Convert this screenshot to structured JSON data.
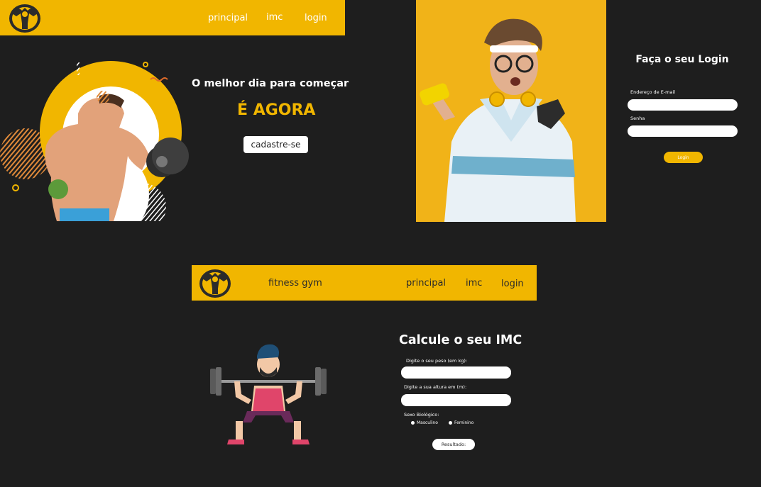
{
  "colors": {
    "accent": "#f1b600",
    "background": "#1e1e1e",
    "field": "#ffffff"
  },
  "home": {
    "nav": {
      "logo_icon": "gym-mascot-logo",
      "links": [
        "principal",
        "imc",
        "login"
      ]
    },
    "hero": {
      "tagline": "O melhor dia para começar",
      "highlight": "É AGORA",
      "signup_label": "cadastre-se"
    }
  },
  "login": {
    "title": "Faça o seu Login",
    "email_label": "Endereço de E-mail",
    "email_value": "",
    "password_label": "Senha",
    "password_value": "",
    "submit_label": "Login"
  },
  "imc": {
    "nav": {
      "logo_icon": "gym-mascot-logo",
      "brand": "fitness gym",
      "links": [
        "principal",
        "imc",
        "login"
      ]
    },
    "title": "Calcule o seu IMC",
    "weight_label": "Digite o seu peso (em kg):",
    "weight_value": "",
    "height_label": "Digite a sua altura em (m):",
    "height_value": "",
    "sex_label": "Sexo Biológico:",
    "sex_options": [
      "Masculino",
      "Feminino"
    ],
    "result_label": "Resultado:"
  }
}
